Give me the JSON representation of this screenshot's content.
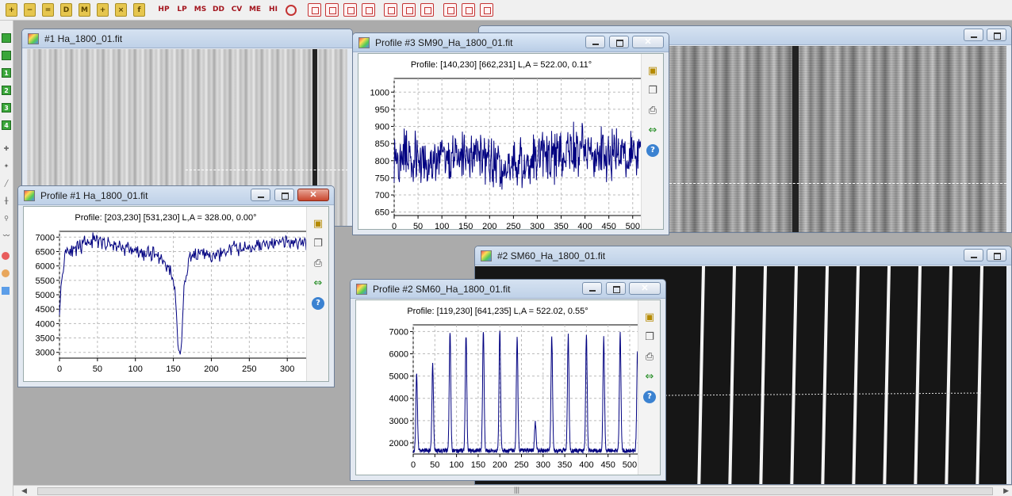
{
  "toolbar": {
    "yellow_icons": [
      "add-icon",
      "subtract-icon",
      "multiply-icon",
      "divide-icon",
      "multiply-icon",
      "plus-icon",
      "cross-icon",
      "function-icon"
    ],
    "yellow_labels": [
      "+",
      "−",
      "=",
      "D",
      "M",
      "+",
      "×",
      "f"
    ],
    "text_buttons": [
      "HP",
      "LP",
      "MS",
      "DD",
      "CV",
      "ME",
      "HI"
    ]
  },
  "left_toolbar": {
    "numbers": [
      "1",
      "2",
      "3",
      "4"
    ]
  },
  "windows": {
    "ha": {
      "title": "#1 Ha_1800_01.fit"
    },
    "sm90": {
      "title": ""
    },
    "sm60": {
      "title": "#2 SM60_Ha_1800_01.fit"
    }
  },
  "profiles": {
    "p3": {
      "window_title": "Profile #3 SM90_Ha_1800_01.fit",
      "header": "Profile: [140,230] [662,231]  L,A = 522.00, 0.11°",
      "chart_data": {
        "type": "line",
        "xlim": [
          0,
          522
        ],
        "ylim": [
          640,
          1040
        ],
        "xticks": [
          0,
          50,
          100,
          150,
          200,
          250,
          300,
          350,
          400,
          450,
          500
        ],
        "yticks": [
          650,
          700,
          750,
          800,
          850,
          900,
          950,
          1000
        ],
        "grid": true,
        "color": "#000080",
        "series": [
          {
            "style": "noise",
            "x": [
              0,
              80,
              160,
              200,
              260,
              330,
              400,
              460,
              522
            ],
            "y": [
              820,
              800,
              830,
              790,
              780,
              820,
              830,
              820,
              830
            ],
            "spread": 80
          }
        ]
      }
    },
    "p1": {
      "window_title": "Profile #1 Ha_1800_01.fit",
      "header": "Profile: [203,230] [531,230]  L,A = 328.00, 0.00°",
      "chart_data": {
        "type": "line",
        "xlim": [
          0,
          328
        ],
        "ylim": [
          2800,
          7200
        ],
        "xticks": [
          0,
          50,
          100,
          150,
          200,
          250,
          300
        ],
        "yticks": [
          3000,
          3500,
          4000,
          4500,
          5000,
          5500,
          6000,
          6500,
          7000
        ],
        "grid": true,
        "color": "#000080",
        "series": [
          {
            "style": "noise",
            "x": [
              0,
              3,
              8,
              20,
              40,
              60,
              90,
              110,
              130,
              145,
              152,
              157,
              160,
              164,
              170,
              190,
              200,
              230,
              260,
              300,
              328
            ],
            "y": [
              4500,
              5500,
              6600,
              6500,
              6900,
              6800,
              6600,
              6400,
              6400,
              5900,
              5200,
              3000,
              3000,
              5200,
              6300,
              6400,
              6300,
              6600,
              6700,
              6800,
              6800
            ],
            "spread": 280
          }
        ]
      }
    },
    "p2": {
      "window_title": "Profile #2 SM60_Ha_1800_01.fit",
      "header": "Profile: [119,230] [641,235]  L,A = 522.02, 0.55°",
      "chart_data": {
        "type": "line",
        "xlim": [
          0,
          522
        ],
        "ylim": [
          1500,
          7300
        ],
        "xticks": [
          0,
          50,
          100,
          150,
          200,
          250,
          300,
          350,
          400,
          450,
          500
        ],
        "yticks": [
          2000,
          3000,
          4000,
          5000,
          6000,
          7000
        ],
        "grid": true,
        "color": "#000080",
        "series": [
          {
            "style": "peaks",
            "baseline": 1650,
            "peaks_x": [
              8,
              45,
              85,
              122,
              162,
              200,
              240,
              282,
              320,
              358,
              400,
              440,
              478,
              518
            ],
            "peaks_y": [
              5100,
              5500,
              7000,
              6800,
              7000,
              7100,
              6700,
              2900,
              6700,
              6800,
              6800,
              6700,
              6900,
              6100
            ],
            "width": 2.5,
            "spread": 100
          }
        ]
      }
    },
    "side_icons": [
      "save-icon",
      "copy-icon",
      "print-icon",
      "swap-icon",
      "help-icon"
    ]
  }
}
